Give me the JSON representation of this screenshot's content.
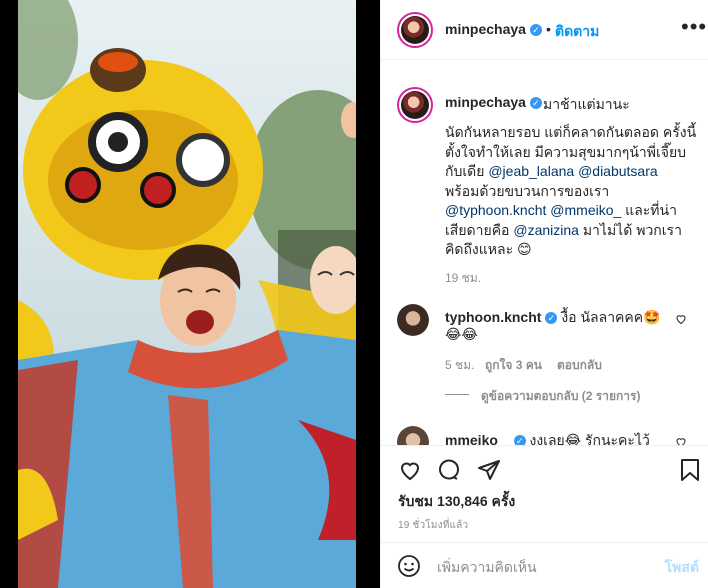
{
  "header": {
    "username": "minpechaya",
    "dot": "•",
    "follow_label": "ติดตาม",
    "more": "•••"
  },
  "caption": {
    "username": "minpechaya",
    "first_line": "มาช้าแต่มานะ",
    "lines": [
      "นัดกันหลายรอบ แต่ก็คลาดกันตลอด ครั้งนี้",
      "ตั้งใจทำให้เลย มีความสุขมากๆน้าพี่เจี๊ยบ",
      "กับเดีย",
      "พร้อมด้วยขบวนการของเรา",
      "",
      "เสียดายคือ",
      "คิดถึงแหละ 😊"
    ],
    "m_jeab": "@jeab_lalana",
    "m_dia": "@diabutsara",
    "m_typhoon": "@typhoon.kncht",
    "m_meiko": "@mmeiko_",
    "and_sad": " และที่น่า",
    "m_zanizina": "@zanizina",
    "not_come": " มาไม่ได้ พวกเรา",
    "time": "19 ชม."
  },
  "comment1": {
    "username": "typhoon.kncht",
    "text": "งื้อ นัลลาคคค🤩",
    "emoji_line": "😂😂",
    "time": "5 ชม.",
    "likes": "ถูกใจ 3 คน",
    "reply": "ตอบกลับ",
    "view_replies": "ดูข้อความตอบกลับ (2 รายการ)"
  },
  "comment2": {
    "username": "mmeiko_",
    "text": "งงเลย😂 รักนะคะไว้"
  },
  "stats": {
    "views": "รับชม 130,846 ครั้ง",
    "time": "19 ชั่วโมงที่แล้ว"
  },
  "add_comment": {
    "placeholder": "เพิ่มความคิดเห็น",
    "post": "โพสต์"
  },
  "colors": {
    "accent": "#0095f6",
    "mention": "#00376b",
    "muted": "#8e8e8e",
    "lion_yellow": "#f2c81a",
    "dress_blue": "#5aa9d8"
  },
  "icons": [
    "verified-badge-icon",
    "more-options-icon",
    "heart-icon",
    "comment-icon",
    "share-icon",
    "bookmark-icon",
    "emoji-icon"
  ]
}
